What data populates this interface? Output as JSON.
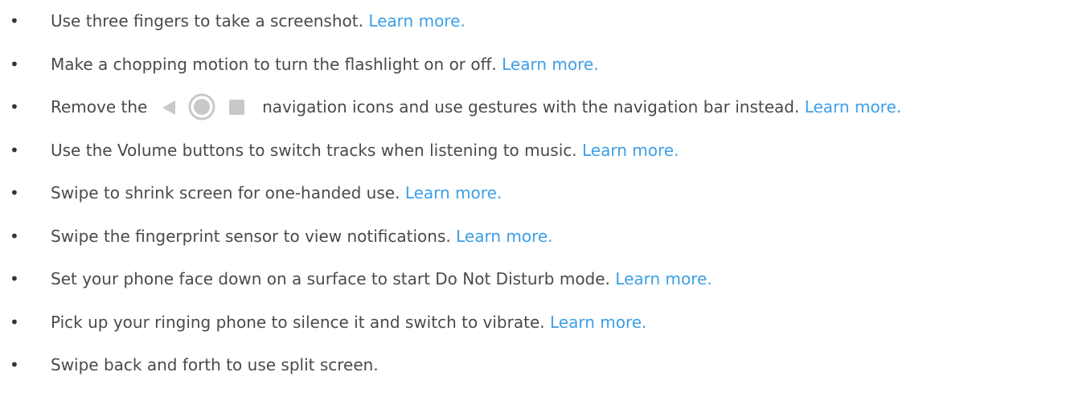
{
  "items": [
    {
      "text": "Use three fingers to take a screenshot.",
      "link": "Learn more."
    },
    {
      "text": "Make a chopping motion to turn the flashlight on or off.",
      "link": "Learn more."
    },
    {
      "text_before": "Remove the",
      "text_after": "navigation icons and use gestures with the navigation bar instead.",
      "link": "Learn more.",
      "icons": [
        "back-triangle-icon",
        "home-circle-icon",
        "recents-square-icon"
      ]
    },
    {
      "text": "Use the Volume buttons to switch tracks when listening to music.",
      "link": "Learn more."
    },
    {
      "text": "Swipe to shrink screen for one-handed use.",
      "link": "Learn more."
    },
    {
      "text": "Swipe the fingerprint sensor to view notifications.",
      "link": "Learn more."
    },
    {
      "text": "Set your phone face down on a surface to start Do Not Disturb mode.",
      "link": "Learn more."
    },
    {
      "text": "Pick up your ringing phone to silence it and switch to vibrate.",
      "link": "Learn more."
    },
    {
      "text": "Swipe back and forth to use split screen."
    }
  ],
  "colors": {
    "text": "#4a4a4a",
    "link": "#3d9fe6",
    "icon": "#c8c8c8"
  }
}
